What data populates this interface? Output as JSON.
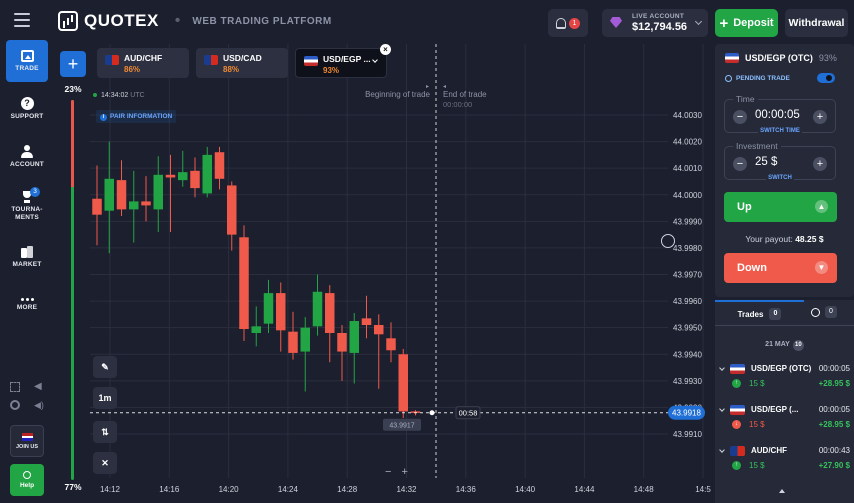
{
  "header": {
    "logo_text": "QUOTEX",
    "tagline": "WEB TRADING PLATFORM",
    "notification_count": "1",
    "account_label": "LIVE ACCOUNT",
    "balance": "$12,794.56",
    "deposit_label": "Deposit",
    "withdraw_label": "Withdrawal"
  },
  "nav": {
    "trade": "TRADE",
    "support": "SUPPORT",
    "account": "ACCOUNT",
    "tournaments": "TOURNA-\nMENTS",
    "tournaments_badge": "3",
    "market": "MARKET",
    "more": "MORE",
    "join_us": "JOIN US",
    "help": "Help"
  },
  "sentiment": {
    "top_pct": "23%",
    "bottom_pct": "77%",
    "sell_fraction": 0.23
  },
  "asset_tabs": [
    {
      "name": "AUD/CHF",
      "payout": "86%"
    },
    {
      "name": "USD/CAD",
      "payout": "88%"
    },
    {
      "name": "USD/EGP ...",
      "payout": "93%"
    }
  ],
  "chart": {
    "clock": "14:34:02",
    "utc": "UTC",
    "pair_info": "PAIR INFORMATION",
    "beginning_label": "Beginning of trade",
    "end_label": "End of trade",
    "end_time": "00:00:00",
    "timeframe": "1m",
    "zoom_minus": "−",
    "zoom_plus": "+",
    "current_price": "43.9918",
    "countdown": "00:58",
    "crosshair_price": "43.9917"
  },
  "chart_data": {
    "type": "candlestick",
    "y_ticks": [
      "44.0030",
      "44.0020",
      "44.0010",
      "44.0000",
      "43.9990",
      "43.9980",
      "43.9970",
      "43.9960",
      "43.9950",
      "43.9940",
      "43.9930",
      "43.9920",
      "43.9910"
    ],
    "x_ticks": [
      "14:12",
      "14:16",
      "14:20",
      "14:24",
      "14:28",
      "14:32",
      "14:36",
      "14:40",
      "14:44",
      "14:48",
      "14:5"
    ],
    "ylim": [
      43.9905,
      44.0038
    ],
    "candles": [
      {
        "o": 43.99985,
        "c": 43.99925,
        "h": 44.0011,
        "l": 43.9981
      },
      {
        "o": 43.9994,
        "c": 44.0006,
        "h": 44.002,
        "l": 43.9978
      },
      {
        "o": 44.00055,
        "c": 43.99945,
        "h": 44.0013,
        "l": 43.9992
      },
      {
        "o": 43.99945,
        "c": 43.99975,
        "h": 44.0009,
        "l": 43.9982
      },
      {
        "o": 43.99975,
        "c": 43.9996,
        "h": 44.0007,
        "l": 43.999
      },
      {
        "o": 43.99945,
        "c": 44.00075,
        "h": 44.00145,
        "l": 43.9986
      },
      {
        "o": 44.00075,
        "c": 44.00065,
        "h": 44.0015,
        "l": 43.9986
      },
      {
        "o": 44.00055,
        "c": 44.00085,
        "h": 44.00165,
        "l": 44.0003
      },
      {
        "o": 44.0009,
        "c": 44.00025,
        "h": 44.0014,
        "l": 43.9999
      },
      {
        "o": 44.00005,
        "c": 44.0015,
        "h": 44.0018,
        "l": 43.9999
      },
      {
        "o": 44.0016,
        "c": 44.0006,
        "h": 44.0018,
        "l": 44.0002
      },
      {
        "o": 44.00035,
        "c": 43.9985,
        "h": 44.0005,
        "l": 43.9979
      },
      {
        "o": 43.9984,
        "c": 43.99495,
        "h": 43.99885,
        "l": 43.9945
      },
      {
        "o": 43.9948,
        "c": 43.99505,
        "h": 43.9958,
        "l": 43.9943
      },
      {
        "o": 43.99515,
        "c": 43.9963,
        "h": 43.9968,
        "l": 43.9948
      },
      {
        "o": 43.9963,
        "c": 43.9949,
        "h": 43.9967,
        "l": 43.9941
      },
      {
        "o": 43.99485,
        "c": 43.99405,
        "h": 43.9956,
        "l": 43.9938
      },
      {
        "o": 43.9941,
        "c": 43.995,
        "h": 43.9954,
        "l": 43.9926
      },
      {
        "o": 43.99505,
        "c": 43.99635,
        "h": 43.997,
        "l": 43.9947
      },
      {
        "o": 43.9963,
        "c": 43.9948,
        "h": 43.9966,
        "l": 43.9937
      },
      {
        "o": 43.9948,
        "c": 43.9941,
        "h": 43.9951,
        "l": 43.993
      },
      {
        "o": 43.99405,
        "c": 43.99525,
        "h": 43.99555,
        "l": 43.9929
      },
      {
        "o": 43.99535,
        "c": 43.9951,
        "h": 43.9962,
        "l": 43.9946
      },
      {
        "o": 43.9951,
        "c": 43.99475,
        "h": 43.9955,
        "l": 43.9927
      },
      {
        "o": 43.9946,
        "c": 43.99415,
        "h": 43.9952,
        "l": 43.9937
      },
      {
        "o": 43.994,
        "c": 43.99185,
        "h": 43.9942,
        "l": 43.9916
      },
      {
        "o": 43.99185,
        "c": 43.9918,
        "h": 43.9919,
        "l": 43.9917
      }
    ]
  },
  "trade_panel": {
    "asset": "USD/EGP (OTC)",
    "asset_pct": "93%",
    "pending_label": "PENDING TRADE",
    "time_label": "Time",
    "time_value": "00:00:05",
    "switch_time": "SWITCH TIME",
    "investment_label": "Investment",
    "investment_value": "25 $",
    "switch": "SWITCH",
    "minus": "−",
    "plus": "+",
    "up_label": "Up",
    "down_label": "Down",
    "payout_label": "Your payout:",
    "payout_value": "48.25 $"
  },
  "trades": {
    "tab_label": "Trades",
    "tab_count": "0",
    "history_count": "0",
    "date": "21 MAY",
    "date_count": "10",
    "items": [
      {
        "asset": "USD/EGP (OTC)",
        "time": "00:00:05",
        "amount": "15 $",
        "profit": "+28.95 $",
        "direction": "up"
      },
      {
        "asset": "USD/EGP (...",
        "time": "00:00:05",
        "amount": "15 $",
        "profit": "+28.95 $",
        "direction": "down"
      },
      {
        "asset": "AUD/CHF",
        "time": "00:00:43",
        "amount": "15 $",
        "profit": "+27.90 $",
        "direction": "up"
      }
    ]
  },
  "colors": {
    "green": "#22a545",
    "red": "#ef5a4a",
    "blue": "#1f6fd6",
    "orange": "#f08a34"
  }
}
